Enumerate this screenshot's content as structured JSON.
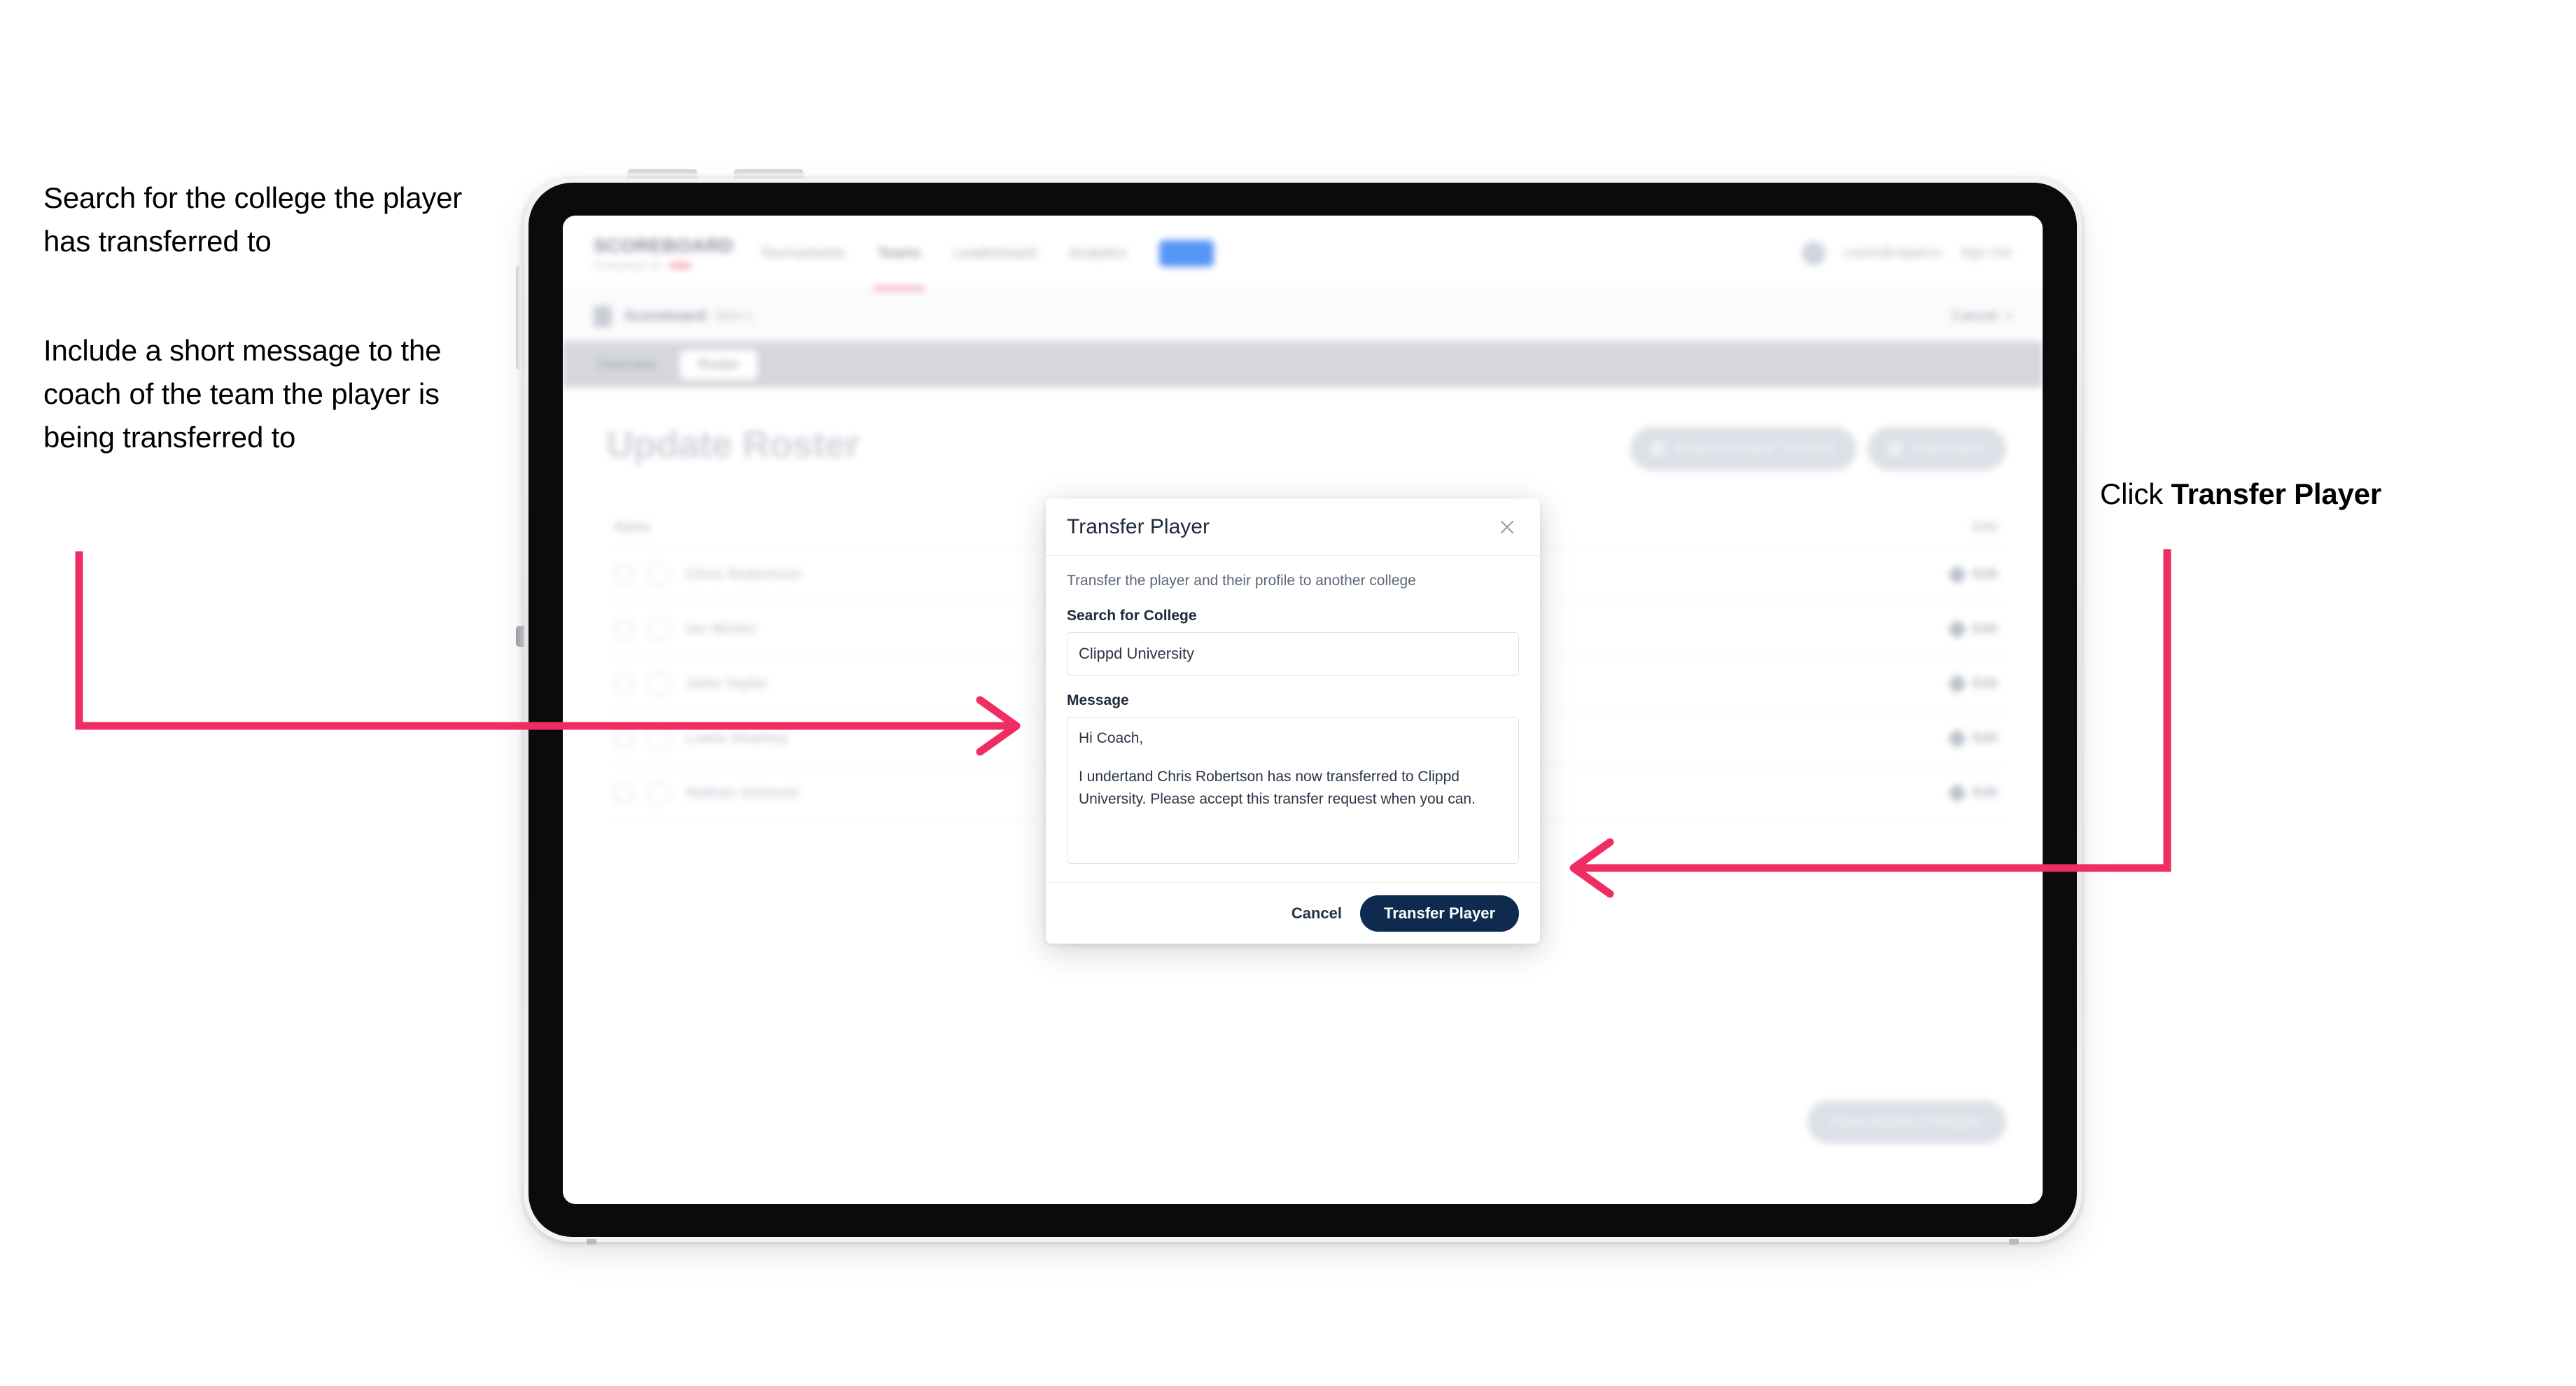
{
  "annotations": {
    "left_1": "Search for the college the player has transferred to",
    "left_2": "Include a short message to the coach of the team the player is being transferred to",
    "right_prefix": "Click ",
    "right_bold": "Transfer Player"
  },
  "colors": {
    "arrow": "#F02D63",
    "primary_navy": "#0E2B4F",
    "brand_accent": "#F3A6B8",
    "nav_pill": "#5596F6"
  },
  "app": {
    "header": {
      "brand_word": "SCOREBOARD",
      "brand_sub": "POWERED BY",
      "nav": [
        {
          "label": "Tournaments",
          "active": false
        },
        {
          "label": "Teams",
          "active": true
        },
        {
          "label": "Leaderboard",
          "active": false
        },
        {
          "label": "Analytics",
          "active": false
        }
      ],
      "nav_pill": "Beta",
      "user_email": "coach@clippd.io",
      "sign_out": "Sign Out"
    },
    "breadcrumb": {
      "icon": "scoreboard-icon",
      "main": "Scoreboard",
      "sub": "Men's",
      "cancel": "Cancel",
      "chevron": "chevron-down-icon"
    },
    "tabs": [
      {
        "label": "Overview",
        "active": false
      },
      {
        "label": "Roster",
        "active": true
      }
    ],
    "page": {
      "title": "Update Roster",
      "actions": [
        {
          "icon": "download-icon",
          "label": "Request Player Transfer"
        },
        {
          "icon": "plus-icon",
          "label": "Add Player"
        }
      ],
      "roster_columns": {
        "name": "Name",
        "edit": "Edit"
      },
      "roster_rows": [
        {
          "name": "Chris Robertson",
          "edit": "Edit"
        },
        {
          "name": "Ian Winter",
          "edit": "Edit"
        },
        {
          "name": "John Taylor",
          "edit": "Edit"
        },
        {
          "name": "Lewis Sharkey",
          "edit": "Edit"
        },
        {
          "name": "Nathan Vermont",
          "edit": "Edit"
        }
      ],
      "save_button": "Save Roster Changes"
    }
  },
  "modal": {
    "title": "Transfer Player",
    "close_icon": "close-icon",
    "description": "Transfer the player and their profile to another college",
    "college_label": "Search for College",
    "college_value": "Clippd University",
    "college_placeholder": "Search for College",
    "message_label": "Message",
    "message_line_1": "Hi Coach,",
    "message_line_2": "I undertand Chris Robertson has now transferred to Clippd University. Please accept this transfer request when you can.",
    "cancel_label": "Cancel",
    "submit_label": "Transfer Player"
  }
}
